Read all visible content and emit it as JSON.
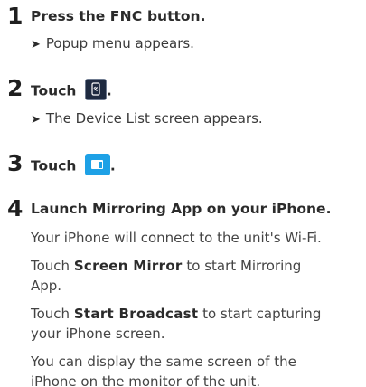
{
  "steps": [
    {
      "number": "1",
      "heading_pre": "Press the ",
      "heading_key": "FNC",
      "heading_post": " button.",
      "result": "Popup menu appears."
    },
    {
      "number": "2",
      "heading_pre": "Touch",
      "icon": "device-list-icon",
      "heading_post": ".",
      "result": "The Device List screen appears."
    },
    {
      "number": "3",
      "heading_pre": "Touch",
      "icon": "screen-mirroring-icon",
      "heading_post": "."
    },
    {
      "number": "4",
      "heading": "Launch Mirroring App on your iPhone.",
      "line1": "Your iPhone will connect to the unit's Wi-Fi.",
      "line2_pre": "Touch ",
      "line2_key": "Screen Mirror",
      "line2_post": " to start Mirroring",
      "line3": "App.",
      "line4_pre": "Touch ",
      "line4_key": "Start Broadcast",
      "line4_post": " to start capturing",
      "line5": "your iPhone screen.",
      "line6": "You can display the same screen of the",
      "line7": "iPhone on the monitor of the unit."
    }
  ],
  "colors": {
    "device_icon_bg": "#1e2a40",
    "mirror_icon_bg": "#1ea1e6"
  }
}
